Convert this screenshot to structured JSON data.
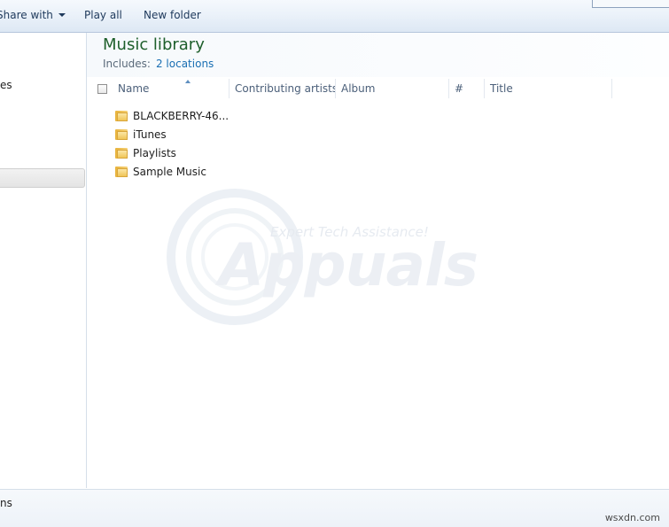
{
  "toolbar": {
    "share_label": "Share with",
    "play_all_label": "Play all",
    "new_folder_label": "New folder"
  },
  "nav": {
    "partial_item_text": "es"
  },
  "library": {
    "title": "Music library",
    "includes_label": "Includes:",
    "locations_link": "2 locations"
  },
  "columns": [
    "Name",
    "Contributing artists",
    "Album",
    "#",
    "Title"
  ],
  "items": [
    {
      "name": "BLACKBERRY-46..."
    },
    {
      "name": "iTunes"
    },
    {
      "name": "Playlists"
    },
    {
      "name": "Sample Music"
    }
  ],
  "watermark": {
    "tagline": "Expert Tech Assistance!",
    "brand": "Appuals"
  },
  "status": {
    "partial_text": "ns",
    "site_mark": "wsxdn.com"
  },
  "icons": {
    "folder": "folder-icon",
    "caret": "chevron-down-icon",
    "sort": "sort-ascending-icon"
  }
}
